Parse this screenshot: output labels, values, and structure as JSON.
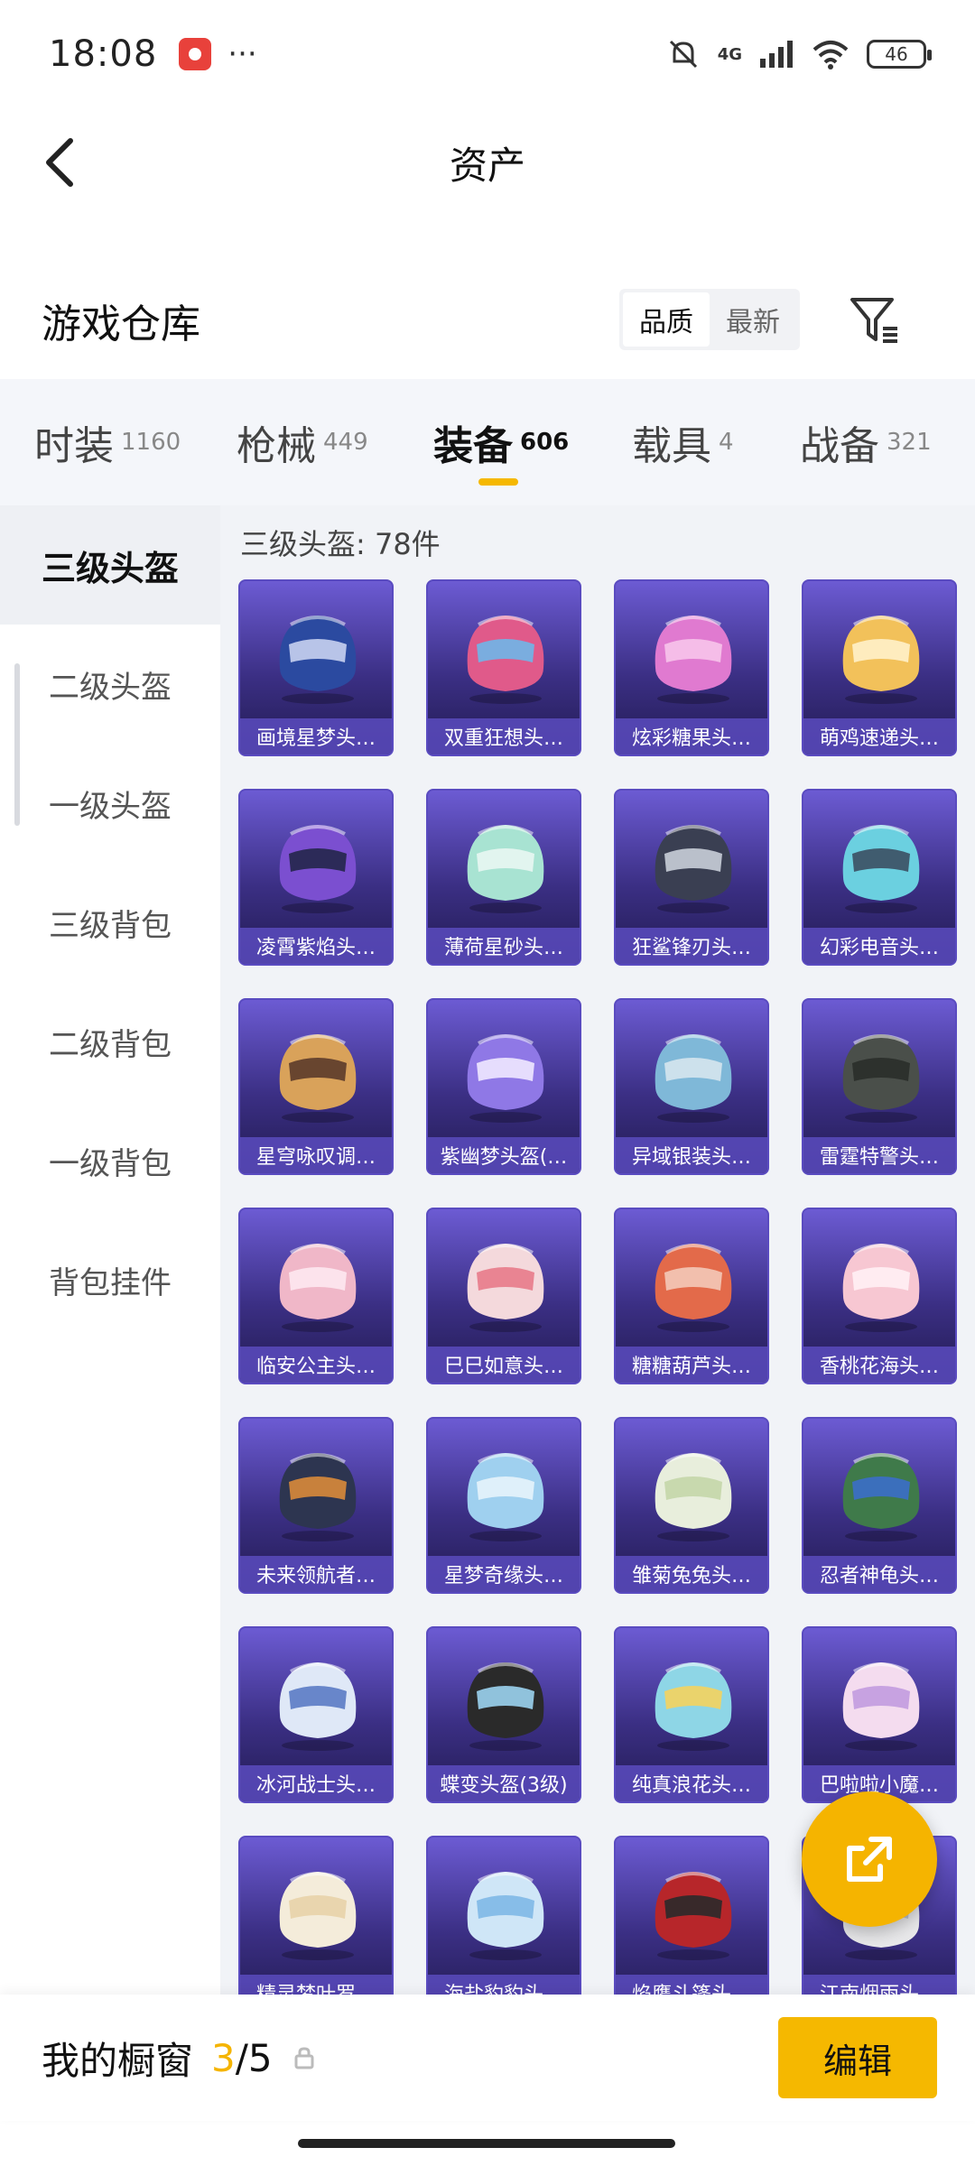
{
  "status_bar": {
    "time": "18:08",
    "more": "···",
    "network": "4G",
    "battery": "46"
  },
  "header": {
    "title": "资产"
  },
  "warehouse": {
    "title": "游戏仓库",
    "sort_options": [
      "品质",
      "最新"
    ],
    "sort_selected": "品质"
  },
  "tabs": [
    {
      "label": "时装",
      "count": "1160"
    },
    {
      "label": "枪械",
      "count": "449"
    },
    {
      "label": "装备",
      "count": "606",
      "active": true
    },
    {
      "label": "载具",
      "count": "4"
    },
    {
      "label": "战备",
      "count": "321"
    }
  ],
  "sidebar": {
    "items": [
      "三级头盔",
      "二级头盔",
      "一级头盔",
      "三级背包",
      "二级背包",
      "一级背包",
      "背包挂件"
    ],
    "active": "三级头盔"
  },
  "content": {
    "count_label": "三级头盔: 78件",
    "items": [
      "画境星梦头…",
      "双重狂想头…",
      "炫彩糖果头…",
      "萌鸡速递头…",
      "凌霄紫焰头…",
      "薄荷星砂头…",
      "狂鲨锋刃头…",
      "幻彩电音头…",
      "星穹咏叹调…",
      "紫幽梦头盔(…",
      "异域银装头…",
      "雷霆特警头…",
      "临安公主头…",
      "巳巳如意头…",
      "糖糖葫芦头…",
      "香桃花海头…",
      "未来领航者…",
      "星梦奇缘头…",
      "雏菊兔兔头…",
      "忍者神龟头…",
      "冰河战士头…",
      "蝶变头盔(3级)",
      "纯真浪花头…",
      "巴啦啦小魔…",
      "精灵梦叶罗…",
      "海盐豹豹头…",
      "焰鹰斗篷头…",
      "江南烟雨头…"
    ]
  },
  "bottom_bar": {
    "label": "我的橱窗",
    "current": "3",
    "total": "/5",
    "edit": "编辑"
  },
  "colors": {
    "accent": "#f5b800",
    "card_top": "#6c5bd3",
    "card_bottom": "#221b52"
  },
  "icons": {
    "back": "chevron-left-icon",
    "filter": "filter-icon",
    "share": "share-icon",
    "lock": "lock-icon"
  }
}
